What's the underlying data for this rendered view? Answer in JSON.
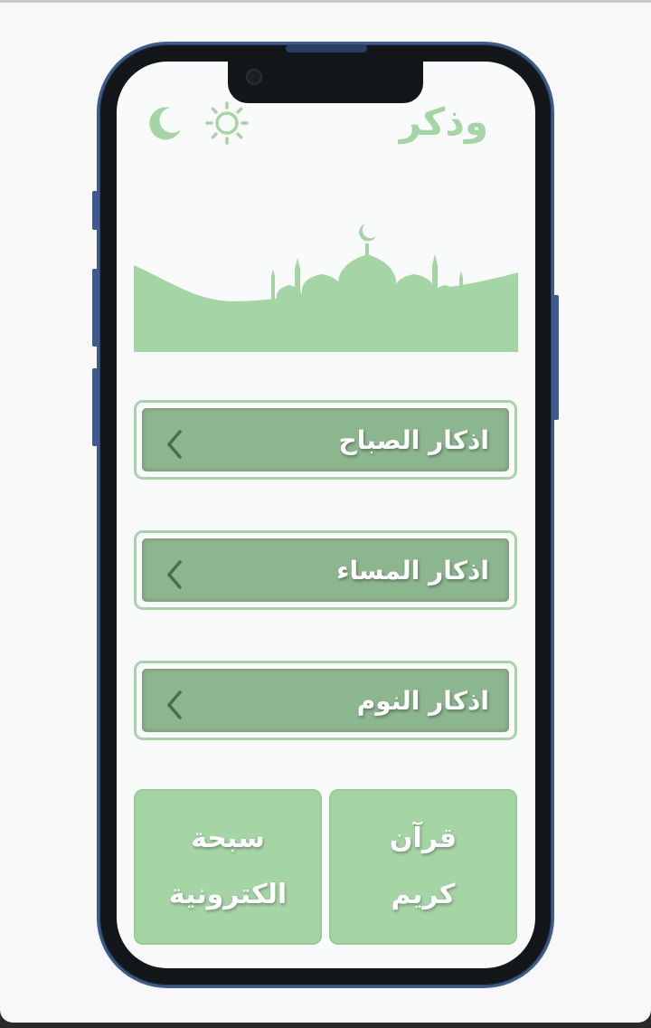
{
  "app": {
    "title": "وذكر"
  },
  "header": {
    "sun_icon": "sun-icon",
    "moon_icon": "moon-icon"
  },
  "colors": {
    "accent": "#a5d4a5",
    "button_fill": "#8cb68e",
    "frame": "#3d5b8c"
  },
  "menu": [
    {
      "label": "اذكار الصباح"
    },
    {
      "label": "اذكار المساء"
    },
    {
      "label": "اذكار النوم"
    }
  ],
  "tiles": {
    "quran": {
      "line1": "قرآن",
      "line2": "كريم"
    },
    "tasbeeh": {
      "line1": "سبحة",
      "line2": "الكترونية"
    }
  }
}
